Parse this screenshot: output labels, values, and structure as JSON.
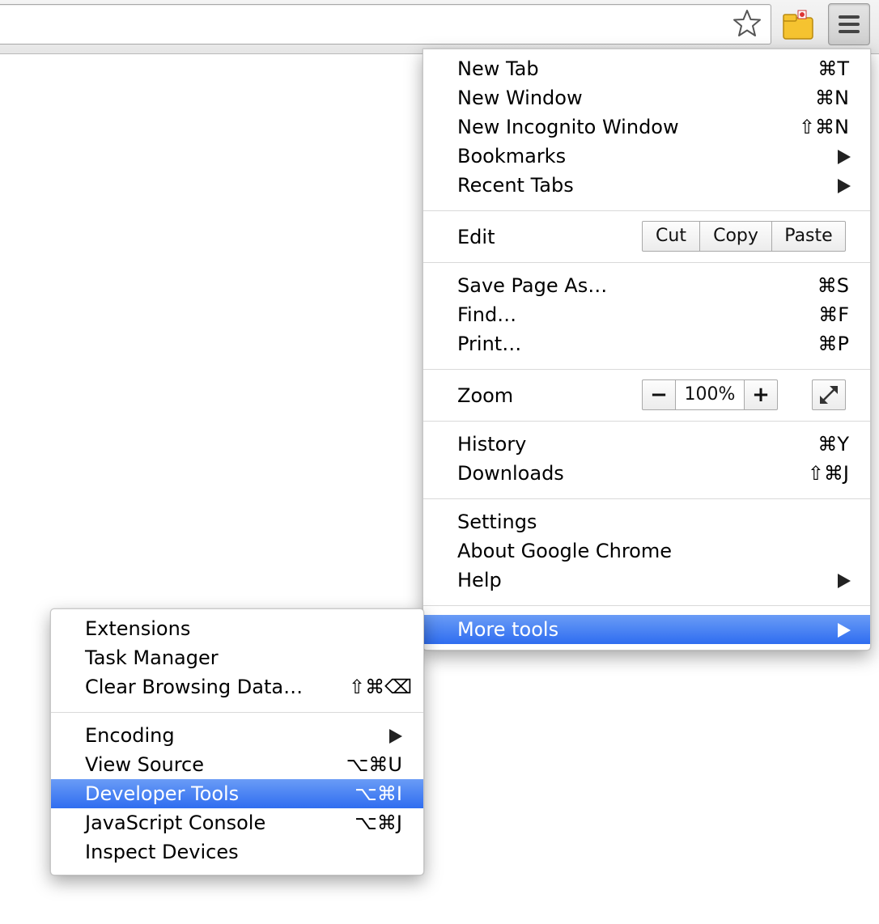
{
  "toolbar": {
    "bookmark_star_icon": "star-icon",
    "extension_icon": "folder-extension-icon",
    "menu_icon": "hamburger-menu-icon"
  },
  "main_menu": {
    "items": [
      {
        "label": "New Tab",
        "shortcut": "⌘T"
      },
      {
        "label": "New Window",
        "shortcut": "⌘N"
      },
      {
        "label": "New Incognito Window",
        "shortcut": "⇧⌘N"
      },
      {
        "label": "Bookmarks",
        "submenu": true
      },
      {
        "label": "Recent Tabs",
        "submenu": true
      }
    ],
    "edit": {
      "label": "Edit",
      "cut": "Cut",
      "copy": "Copy",
      "paste": "Paste"
    },
    "page_items": [
      {
        "label": "Save Page As…",
        "shortcut": "⌘S"
      },
      {
        "label": "Find…",
        "shortcut": "⌘F"
      },
      {
        "label": "Print…",
        "shortcut": "⌘P"
      }
    ],
    "zoom": {
      "label": "Zoom",
      "minus": "−",
      "value": "100%",
      "plus": "+",
      "fullscreen_icon": "fullscreen-icon"
    },
    "history_items": [
      {
        "label": "History",
        "shortcut": "⌘Y"
      },
      {
        "label": "Downloads",
        "shortcut": "⇧⌘J"
      }
    ],
    "settings_items": [
      {
        "label": "Settings"
      },
      {
        "label": "About Google Chrome"
      },
      {
        "label": "Help",
        "submenu": true
      }
    ],
    "more_tools": {
      "label": "More tools",
      "submenu": true,
      "highlighted": true
    }
  },
  "sub_menu": {
    "group1": [
      {
        "label": "Extensions"
      },
      {
        "label": "Task Manager"
      },
      {
        "label": "Clear Browsing Data…",
        "shortcut": "⇧⌘⌫"
      }
    ],
    "group2": [
      {
        "label": "Encoding",
        "submenu": true
      },
      {
        "label": "View Source",
        "shortcut": "⌥⌘U"
      },
      {
        "label": "Developer Tools",
        "shortcut": "⌥⌘I",
        "highlighted": true
      },
      {
        "label": "JavaScript Console",
        "shortcut": "⌥⌘J"
      },
      {
        "label": "Inspect Devices"
      }
    ]
  },
  "colors": {
    "highlight": "#3b78f0",
    "separator": "#d9d9d9"
  }
}
